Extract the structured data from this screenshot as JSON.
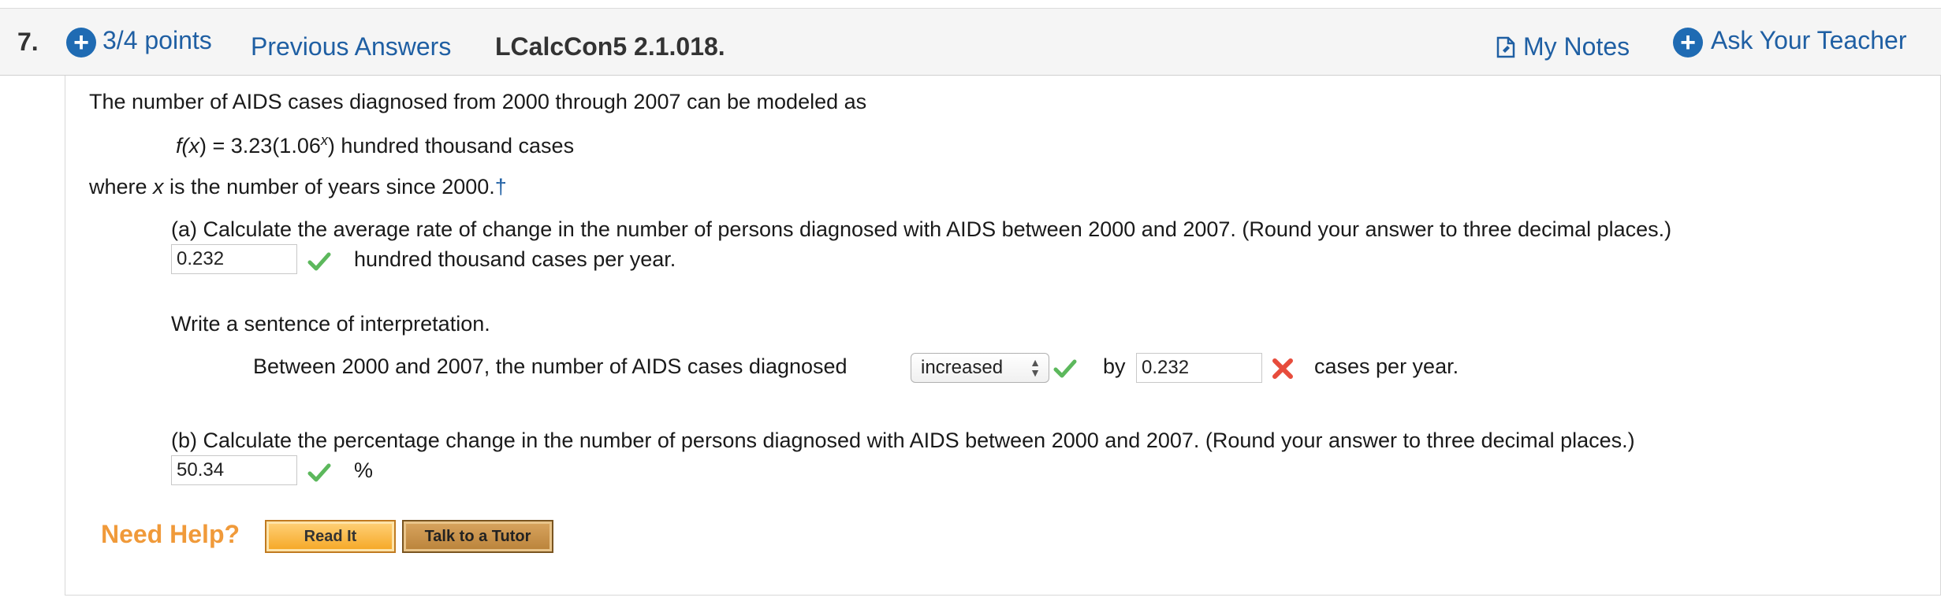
{
  "header": {
    "question_number": "7.",
    "points": "3/4 points",
    "previous_answers": "Previous Answers",
    "question_id": "LCalcCon5 2.1.018.",
    "my_notes": "My Notes",
    "ask_teacher": "Ask Your Teacher"
  },
  "problem": {
    "intro": "The number of AIDS cases diagnosed from 2000 through 2007 can be modeled as",
    "func_lhs": "f(",
    "func_var": "x",
    "func_rhs": ") = 3.23(1.06",
    "func_exp": "x",
    "func_tail": ") hundred thousand cases",
    "where_pre": "where ",
    "where_var": "x",
    "where_post": " is the number of years since 2000.",
    "dagger": "†"
  },
  "part_a": {
    "question": "(a) Calculate the average rate of change in the number of persons diagnosed with AIDS between 2000 and 2007. (Round your answer to three decimal places.)",
    "answer": "0.232",
    "units": "hundred thousand cases per year.",
    "status": "correct"
  },
  "interpretation": {
    "prompt": "Write a sentence of interpretation.",
    "sentence_pre": "Between 2000 and 2007, the number of AIDS cases diagnosed",
    "select_value": "increased",
    "select_status": "correct",
    "by_label": "by",
    "by_answer": "0.232",
    "by_status": "incorrect",
    "sentence_post": "cases per year."
  },
  "part_b": {
    "question": "(b) Calculate the percentage change in the number of persons diagnosed with AIDS between 2000 and 2007. (Round your answer to three decimal places.)",
    "answer": "50.34",
    "units": "%",
    "status": "correct"
  },
  "help": {
    "label": "Need Help?",
    "read_it": "Read It",
    "talk_tutor": "Talk to a Tutor"
  },
  "colors": {
    "link": "#1f5fa3",
    "correct": "#5cb85c",
    "incorrect": "#e74c3c",
    "help_orange": "#f09a3a"
  }
}
